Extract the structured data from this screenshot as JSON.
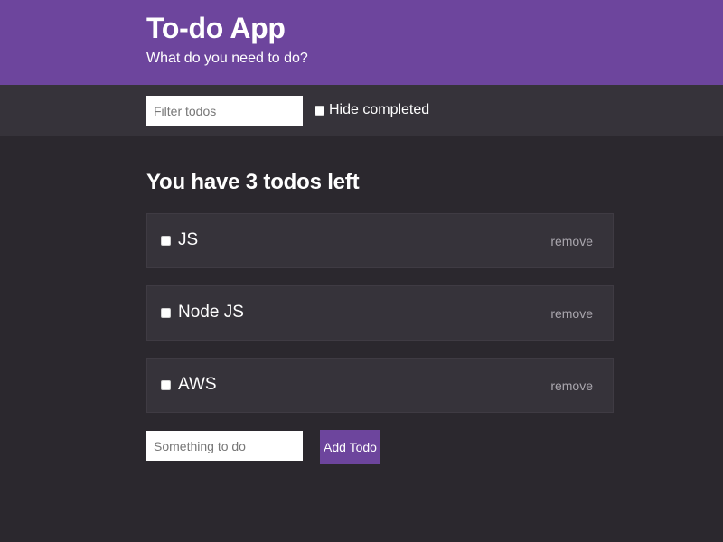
{
  "header": {
    "title": "To-do App",
    "subtitle": "What do you need to do?"
  },
  "filter_bar": {
    "filter_placeholder": "Filter todos",
    "filter_value": "",
    "hide_completed_label": "Hide completed",
    "hide_completed_checked": false
  },
  "main": {
    "heading": "You have 3 todos left",
    "todos": [
      {
        "text": "JS",
        "done": false,
        "remove_label": "remove"
      },
      {
        "text": "Node JS",
        "done": false,
        "remove_label": "remove"
      },
      {
        "text": "AWS",
        "done": false,
        "remove_label": "remove"
      }
    ]
  },
  "add_form": {
    "placeholder": "Something to do",
    "value": "",
    "button_label": "Add Todo"
  },
  "colors": {
    "accent": "#6d459d",
    "background": "#2b282e",
    "panel": "#36333a",
    "muted_text": "#a9a6ad"
  }
}
